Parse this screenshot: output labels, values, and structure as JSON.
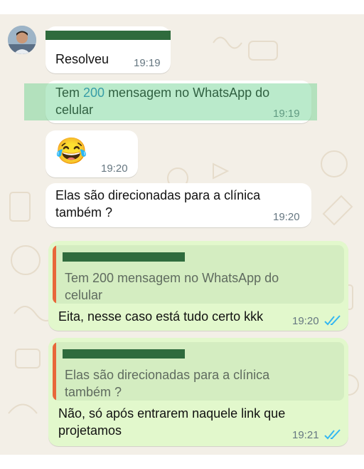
{
  "colors": {
    "wallpaper": "#f3efe7",
    "incoming_bubble": "#ffffff",
    "outgoing_bubble": "#e2f8cc",
    "quote_background": "#d4edc1",
    "quote_accent": "#e8673a",
    "read_ticks": "#34b7f1",
    "highlight": "#5acd82"
  },
  "contact": {
    "avatar_icon": "person-avatar-icon"
  },
  "messages": [
    {
      "direction": "incoming",
      "text": "Resolveu",
      "time": "19:19"
    },
    {
      "direction": "incoming",
      "text_before": "Tem ",
      "text_number": "200",
      "text_after": " mensagem no WhatsApp do celular",
      "time": "19:19"
    },
    {
      "direction": "incoming",
      "emoji": "😂",
      "time": "19:20"
    },
    {
      "direction": "incoming",
      "text": "Elas são direcionadas para a clínica também ?",
      "time": "19:20"
    },
    {
      "direction": "outgoing",
      "quote": "Tem 200 mensagem no WhatsApp do celular",
      "text": "Eita, nesse caso está tudo certo kkk",
      "time": "19:20",
      "status_icon": "double-check-read-icon"
    },
    {
      "direction": "outgoing",
      "quote": "Elas são direcionadas para a clínica também ?",
      "text": "Não, só após entrarem naquele link que projetamos",
      "time": "19:21",
      "status_icon": "double-check-read-icon"
    }
  ]
}
